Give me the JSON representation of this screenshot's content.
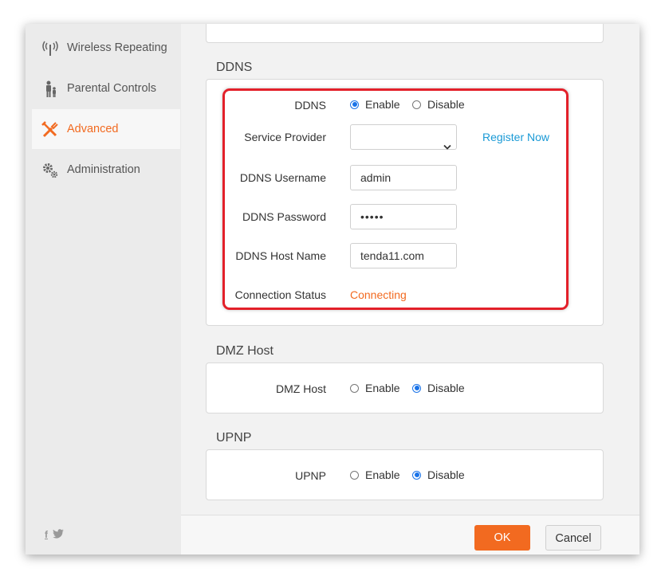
{
  "sidebar": {
    "items": [
      {
        "label": "Wireless Repeating",
        "icon": "wireless-repeating-icon"
      },
      {
        "label": "Parental Controls",
        "icon": "parental-controls-icon"
      },
      {
        "label": "Advanced",
        "icon": "advanced-tools-icon",
        "active": true
      },
      {
        "label": "Administration",
        "icon": "administration-gears-icon"
      }
    ],
    "social": {
      "facebook": "f",
      "twitter": "twitter-icon"
    }
  },
  "ddns": {
    "title": "DDNS",
    "ddns_label": "DDNS",
    "enable_label": "Enable",
    "disable_label": "Disable",
    "selected": "Enable",
    "service_provider_label": "Service Provider",
    "service_provider_value": "",
    "register_link": "Register Now",
    "username_label": "DDNS Username",
    "username_value": "admin",
    "password_label": "DDNS Password",
    "password_value": "•••••",
    "hostname_label": "DDNS Host Name",
    "hostname_value": "tenda11.com",
    "status_label": "Connection Status",
    "status_value": "Connecting"
  },
  "dmz": {
    "title": "DMZ Host",
    "label": "DMZ Host",
    "enable_label": "Enable",
    "disable_label": "Disable",
    "selected": "Disable"
  },
  "upnp": {
    "title": "UPNP",
    "label": "UPNP",
    "enable_label": "Enable",
    "disable_label": "Disable",
    "selected": "Disable"
  },
  "footer": {
    "ok_label": "OK",
    "cancel_label": "Cancel"
  },
  "colors": {
    "accent": "#f26a20",
    "link": "#1a9ad6",
    "radio": "#1a73e8",
    "highlight": "#e3202a"
  }
}
